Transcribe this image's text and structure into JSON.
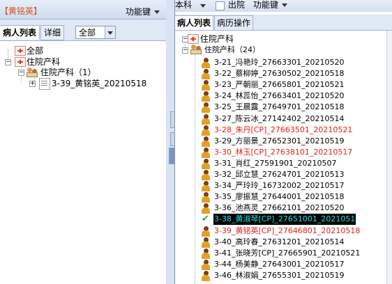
{
  "left": {
    "title": "【黄铭英】",
    "func_label": "功能键",
    "tabs": [
      "病人列表",
      "详细"
    ],
    "filter_value": "全部",
    "tree": [
      "全部",
      "住院产科",
      "住院产科（1）",
      "3-39_黄铭英_20210518"
    ]
  },
  "right": {
    "header_partial": "本科",
    "discharge_label": "出院",
    "func_label": "功能键",
    "tabs": [
      "病人列表",
      "病历操作"
    ],
    "tree_root": "住院产科",
    "group_label": "住院产科（24）",
    "patients": [
      {
        "text": "3-21_冯艳玲_27663301_20210520",
        "style": "normal"
      },
      {
        "text": "3-22_蔡柳婷_27630502_20210518",
        "style": "normal"
      },
      {
        "text": "3-23_严朝丽_27665801_20210521",
        "style": "normal"
      },
      {
        "text": "3-24_林蕊怡_27663401_20210520",
        "style": "normal"
      },
      {
        "text": "3-25_王晨露_27649701_20210518",
        "style": "normal"
      },
      {
        "text": "3-27_陈云冰_27142402_20210514",
        "style": "normal"
      },
      {
        "text": "3-28_朱丹[CP]_27663501_20210521",
        "style": "red"
      },
      {
        "text": "3-29_方丽景_27652301_20210519",
        "style": "normal"
      },
      {
        "text": "3-30_林玉[CP]_27638101_20210517",
        "style": "red"
      },
      {
        "text": "3-31_肖红_27591901_20210507",
        "style": "normal"
      },
      {
        "text": "3-32_邱立慧_27624701_20210513",
        "style": "normal"
      },
      {
        "text": "3-34_严玲玲_16732002_20210517",
        "style": "normal"
      },
      {
        "text": "3-35_廖振慧_27644001_20210518",
        "style": "normal"
      },
      {
        "text": "3-36_池燕灵_27662101_20210520",
        "style": "normal"
      },
      {
        "text": "3-38_黄淑琴[CP]_27651001_2021051",
        "style": "selected"
      },
      {
        "text": "3-39_黄铭英[CP]_27646801_20210518",
        "style": "red"
      },
      {
        "text": "3-40_高玲春_27631201_20210514",
        "style": "normal"
      },
      {
        "text": "3-41_张晓芳[CP]_27665901_20210521",
        "style": "normal"
      },
      {
        "text": "3-44_杨美静_27643001_20210517",
        "style": "normal"
      },
      {
        "text": "3-46_林淑娟_27655301_20210519",
        "style": "normal"
      }
    ]
  },
  "colors": {
    "title": "#d6501e",
    "red": "#e0201b",
    "selected_bg": "#000000",
    "selected_fg": "#19e6e6"
  }
}
